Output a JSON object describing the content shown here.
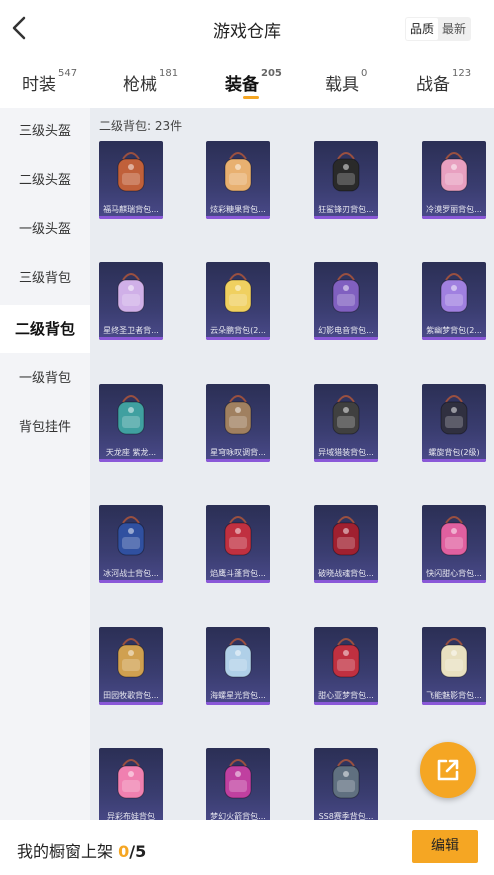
{
  "header": {
    "title": "游戏仓库",
    "sort_options": [
      "品质",
      "最新"
    ],
    "sort_active": 0
  },
  "tabs": [
    {
      "label": "时装",
      "count": "547"
    },
    {
      "label": "枪械",
      "count": "181"
    },
    {
      "label": "装备",
      "count": "205",
      "active": true
    },
    {
      "label": "载具",
      "count": "0"
    },
    {
      "label": "战备",
      "count": "123"
    }
  ],
  "sidebar": [
    {
      "label": "三级头盔"
    },
    {
      "label": "二级头盔"
    },
    {
      "label": "一级头盔"
    },
    {
      "label": "三级背包"
    },
    {
      "label": "二级背包",
      "active": true
    },
    {
      "label": "一级背包"
    },
    {
      "label": "背包挂件"
    }
  ],
  "category_heading": "二级背包: 23件",
  "items": [
    {
      "name": "福马麒瑞背包...",
      "icon": "backpack-icon",
      "color": "#c0603a"
    },
    {
      "name": "炫彩糖果背包...",
      "icon": "backpack-icon",
      "color": "#e8b070"
    },
    {
      "name": "狂鲨锋刃背包...",
      "icon": "backpack-icon",
      "color": "#2a2a2a"
    },
    {
      "name": "冷漠罗丽背包...",
      "icon": "backpack-icon",
      "color": "#e8a0c0"
    },
    {
      "name": "星终圣卫者背...",
      "icon": "backpack-icon",
      "color": "#d0b0e8"
    },
    {
      "name": "云朵鹏背包(2...",
      "icon": "backpack-icon",
      "color": "#f0d060"
    },
    {
      "name": "幻影电音背包...",
      "icon": "backpack-icon",
      "color": "#8060c0"
    },
    {
      "name": "紫幽梦背包(2...",
      "icon": "backpack-icon",
      "color": "#a080e0"
    },
    {
      "name": "天龙座 紫龙...",
      "icon": "backpack-icon",
      "color": "#40a0a0"
    },
    {
      "name": "星穹咏叹调背...",
      "icon": "backpack-icon",
      "color": "#a08060"
    },
    {
      "name": "异域猎装背包...",
      "icon": "backpack-icon",
      "color": "#404040"
    },
    {
      "name": "螺旋背包(2级)",
      "icon": "backpack-icon",
      "color": "#303040"
    },
    {
      "name": "冰河战士背包...",
      "icon": "backpack-icon",
      "color": "#3050a0"
    },
    {
      "name": "焰鹰斗蓬背包...",
      "icon": "backpack-icon",
      "color": "#c03040"
    },
    {
      "name": "破晓战魂背包...",
      "icon": "backpack-icon",
      "color": "#a02030"
    },
    {
      "name": "快闪甜心背包...",
      "icon": "backpack-icon",
      "color": "#e060a0"
    },
    {
      "name": "田园牧歌背包...",
      "icon": "backpack-icon",
      "color": "#d0a050"
    },
    {
      "name": "海螺星光背包...",
      "icon": "backpack-icon",
      "color": "#b0d0e8"
    },
    {
      "name": "甜心亚梦背包...",
      "icon": "backpack-icon",
      "color": "#c03040"
    },
    {
      "name": "飞能魅影背包...",
      "icon": "backpack-icon",
      "color": "#e8e0c0"
    },
    {
      "name": "异彩布娃背包",
      "icon": "backpack-icon",
      "color": "#f080b0"
    },
    {
      "name": "梦幻火箭背包...",
      "icon": "backpack-icon",
      "color": "#c040a0"
    },
    {
      "name": "SS8赛季背包...",
      "icon": "backpack-icon",
      "color": "#607080"
    }
  ],
  "footer": {
    "showcase_label": "我的橱窗上架",
    "current": "0",
    "total": "/5",
    "edit_label": "编辑"
  }
}
